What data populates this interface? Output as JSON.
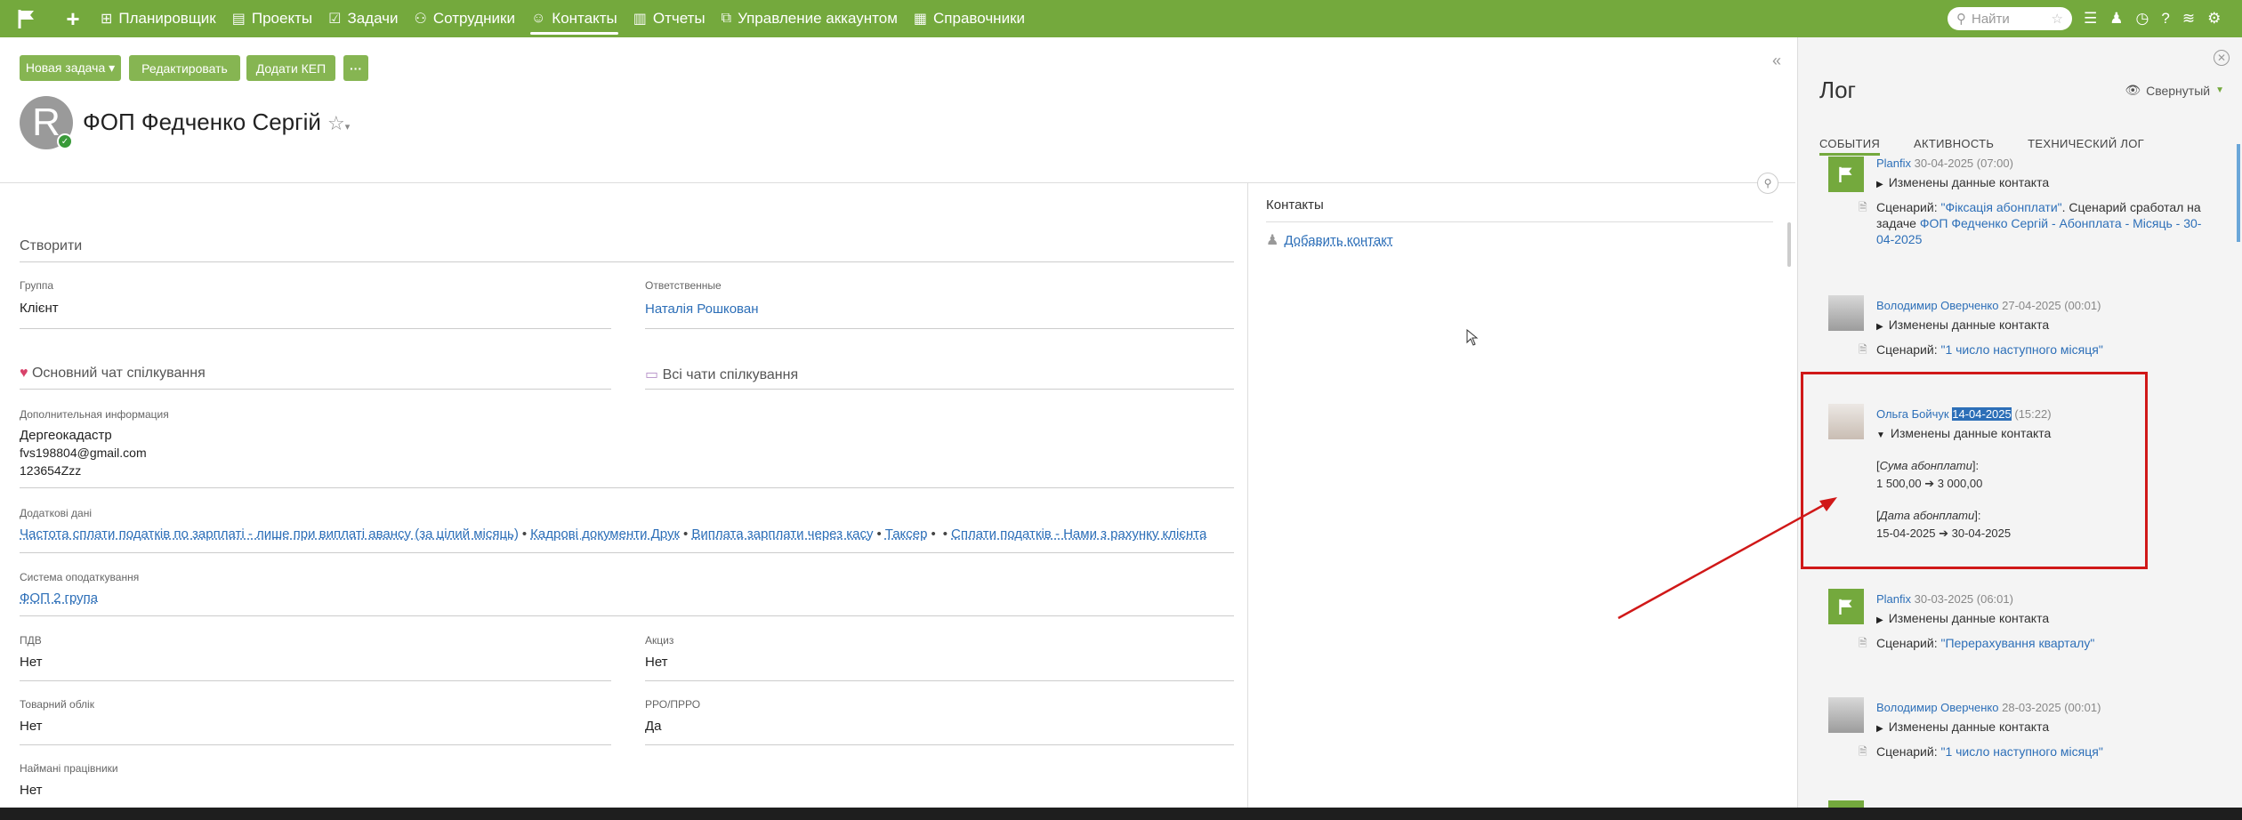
{
  "nav": {
    "items": [
      {
        "label": "Планировщик",
        "icon": "⊞"
      },
      {
        "label": "Проекты",
        "icon": "▤"
      },
      {
        "label": "Задачи",
        "icon": "☑"
      },
      {
        "label": "Сотрудники",
        "icon": "⚇"
      },
      {
        "label": "Контакты",
        "icon": "☺"
      },
      {
        "label": "Отчеты",
        "icon": "▥"
      },
      {
        "label": "Управление аккаунтом",
        "icon": "⧉"
      },
      {
        "label": "Справочники",
        "icon": "▦"
      }
    ],
    "search_placeholder": "Найти"
  },
  "toolbar": {
    "new_task": "Новая задача ▾",
    "edit": "Редактировать",
    "add_kep": "Додати КЕП",
    "more": "···"
  },
  "contact": {
    "avatar_letter": "R",
    "name": "ФОП Федченко Сергій"
  },
  "form": {
    "section_create": "Створити",
    "group_label": "Группа",
    "group_value": "Клієнт",
    "responsible_label": "Ответственные",
    "responsible_value": "Наталія Рошкован",
    "main_chat": "Основний чат спілкування",
    "all_chats": "Всі чати спілкування",
    "additional_info_label": "Дополнительная информация",
    "additional_info_lines": [
      "Дергеокадастр",
      "fvs198804@gmail.com",
      "123654Zzz"
    ],
    "additional_data_label": "Додаткові дані",
    "tags": [
      "Частота сплати податків по зарплаті - лише при виплаті авансу (за цілий місяць)",
      "Кадрові документи Друк",
      "Виплата зарплати через касу",
      "Таксер",
      "Сплати податків - Нами з рахунку клієнта"
    ],
    "tax_system_label": "Система оподаткування",
    "tax_system_value": "ФОП 2 група",
    "vat_label": "ПДВ",
    "vat_value": "Нет",
    "excise_label": "Акциз",
    "excise_value": "Нет",
    "goods_label": "Товарний облік",
    "goods_value": "Нет",
    "rro_label": "РРО/ПРРО",
    "rro_value": "Да",
    "employees_label": "Наймані працівники",
    "employees_value": "Нет"
  },
  "contacts_panel": {
    "title": "Контакты",
    "add": "Добавить контакт"
  },
  "log": {
    "title": "Лог",
    "mode": "Свернутый",
    "tabs": [
      "СОБЫТИЯ",
      "АКТИВНОСТЬ",
      "ТЕХНИЧЕСКИЙ ЛОГ"
    ],
    "entries": [
      {
        "who": "Planfix",
        "when": "30-04-2025 (07:00)",
        "action": "Изменены данные контакта",
        "script_prefix": "Сценарий: ",
        "script_name": "\"Фіксація абонплати\"",
        "script_suffix": ". Сценарий сработал на задаче ",
        "task_link": "ФОП Федченко Сергій - Абонплата - Місяць - 30-04-2025"
      },
      {
        "who": "Володимир Оверченко",
        "when": "27-04-2025 (00:01)",
        "action": "Изменены данные контакта",
        "script_prefix": "Сценарий: ",
        "script_name": "\"1 число наступного місяця\""
      },
      {
        "who": "Ольга Бойчук",
        "date": "14-04-2025",
        "time": "(15:22)",
        "action": "Изменены данные контакта",
        "field1_name": "Сума абонплати",
        "field1_change": "1 500,00 ➔ 3 000,00",
        "field2_name": "Дата абонплати",
        "field2_change": "15-04-2025 ➔ 30-04-2025"
      },
      {
        "who": "Planfix",
        "when": "30-03-2025 (06:01)",
        "action": "Изменены данные контакта",
        "script_prefix": "Сценарий: ",
        "script_name": "\"Перерахування кварталу\""
      },
      {
        "who": "Володимир Оверченко",
        "when": "28-03-2025 (00:01)",
        "action": "Изменены данные контакта",
        "script_prefix": "Сценарий: ",
        "script_name": "\"1 число наступного місяця\""
      }
    ]
  },
  "colors": {
    "brand_green": "#74a93d",
    "button_green": "#86b552",
    "link_blue": "#2d6fb8",
    "annotation_red": "#d01818"
  }
}
